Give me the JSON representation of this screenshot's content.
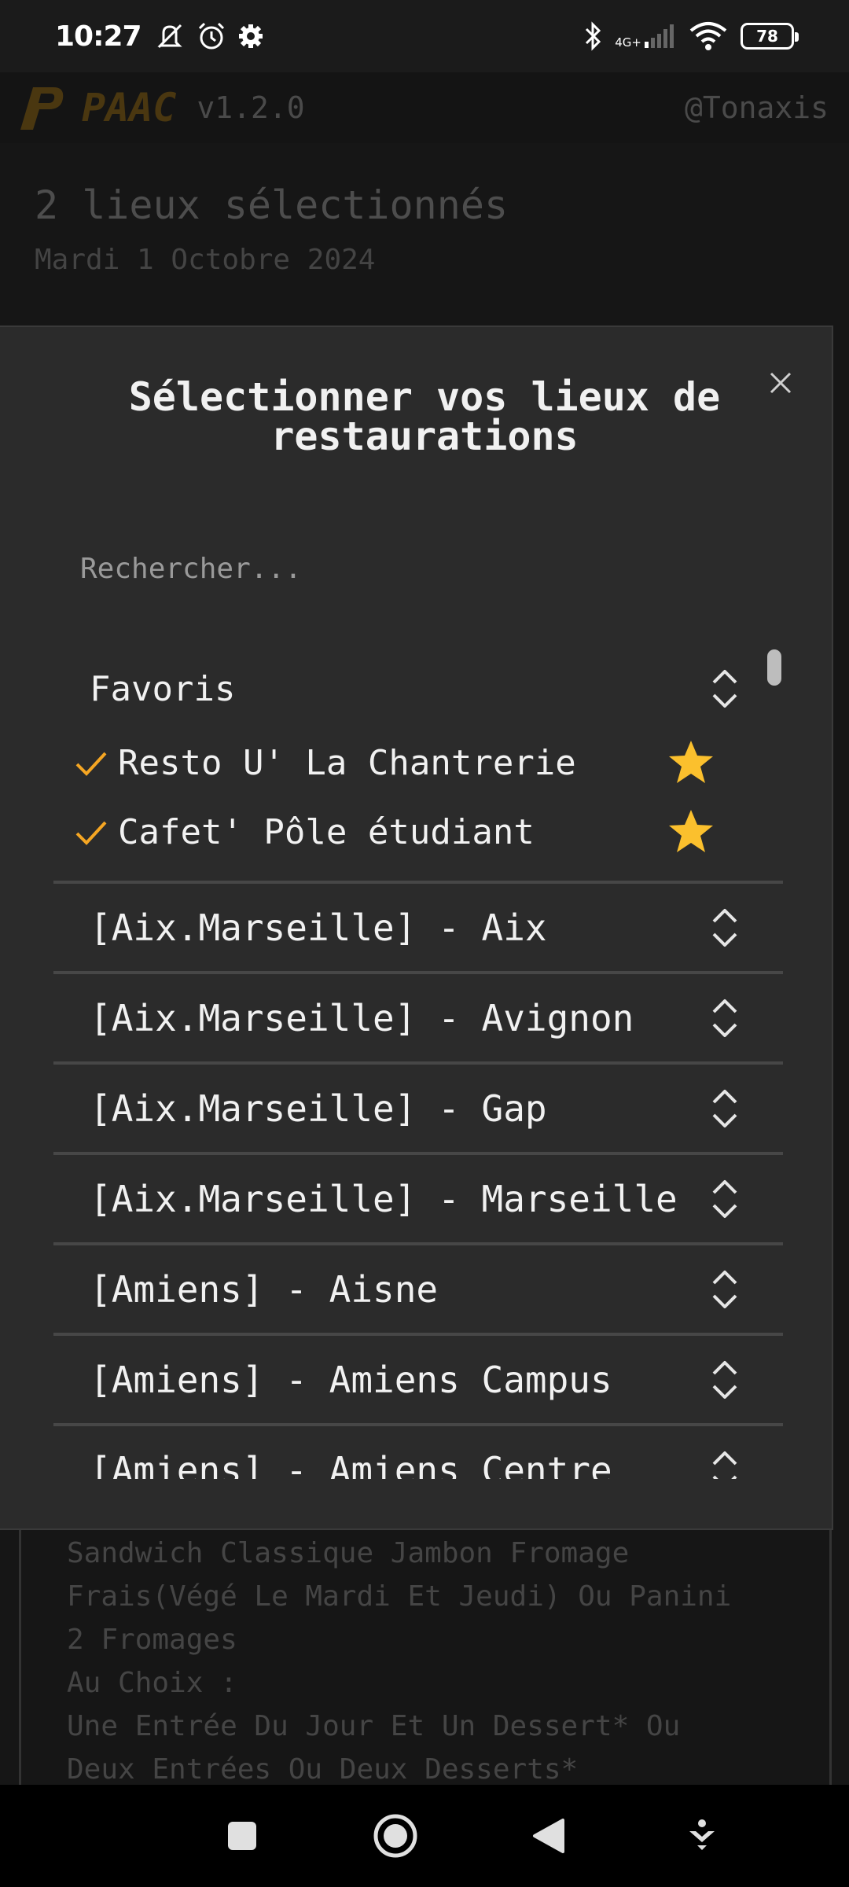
{
  "status_bar": {
    "time": "10:27",
    "network": "4G+",
    "battery": "78"
  },
  "app": {
    "name": "PAAC",
    "version": "v1.2.0",
    "author": "@Tonaxis",
    "brand_color": "#f5a623"
  },
  "summary": {
    "title": "2 lieux sélectionnés",
    "date": "Mardi 1 Octobre 2024"
  },
  "modal": {
    "title_line1": "Sélectionner vos lieux de",
    "title_line2": "restaurations",
    "search_placeholder": "Rechercher...",
    "favorites": {
      "title": "Favoris",
      "items": [
        {
          "label": "Resto U' La Chantrerie",
          "checked": true,
          "favorite": true
        },
        {
          "label": "Cafet' Pôle étudiant",
          "checked": true,
          "favorite": true
        }
      ]
    },
    "groups": [
      {
        "label": "[Aix.Marseille] - Aix"
      },
      {
        "label": "[Aix.Marseille] - Avignon"
      },
      {
        "label": "[Aix.Marseille] - Gap"
      },
      {
        "label": "[Aix.Marseille] - Marseille"
      },
      {
        "label": "[Amiens] - Aisne"
      },
      {
        "label": "[Amiens] - Amiens Campus"
      },
      {
        "label": "[Amiens] - Amiens Centre"
      }
    ]
  },
  "menu_background": {
    "lines": [
      "Sandwich Classique Jambon Fromage",
      "Frais(Végé Le Mardi Et Jeudi) Ou Panini",
      "2 Fromages",
      "Au Choix :",
      "Une Entrée Du Jour Et Un Dessert* Ou",
      "Deux Entrées Ou Deux Desserts*"
    ]
  },
  "colors": {
    "check": "#f5a623",
    "star": "#fbc02d"
  },
  "icons": {
    "close": "close-icon",
    "expand": "chevron-up-down-icon",
    "check": "check-icon",
    "favorite": "star-icon"
  }
}
